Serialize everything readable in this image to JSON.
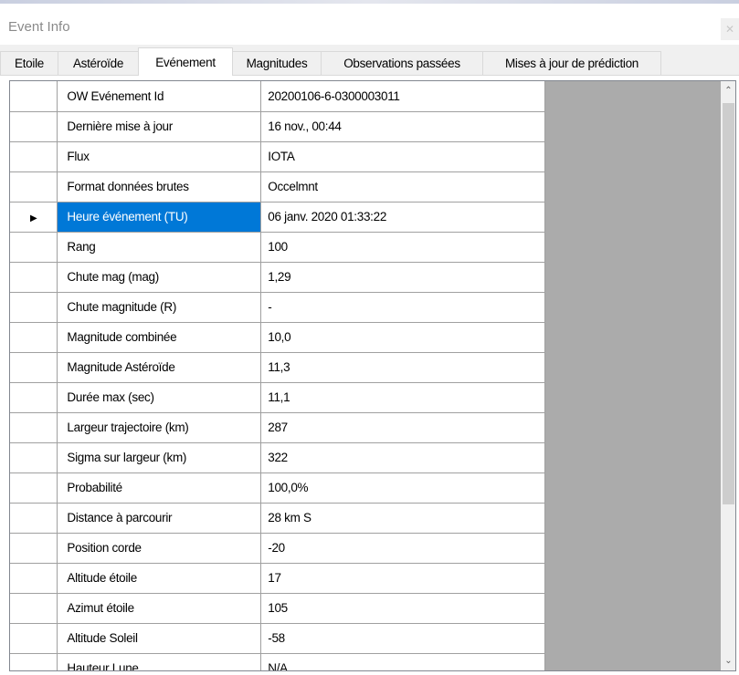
{
  "window": {
    "title": "Event Info",
    "close_glyph": "✕"
  },
  "tabs": [
    {
      "label": "Etoile",
      "active": false
    },
    {
      "label": "Astéroïde",
      "active": false
    },
    {
      "label": "Evénement",
      "active": true
    },
    {
      "label": "Magnitudes",
      "active": false
    },
    {
      "label": "Observations passées",
      "active": false
    },
    {
      "label": "Mises à jour de prédiction",
      "active": false
    }
  ],
  "grid": {
    "selected_row": 4,
    "row_indicator_icon": "right-triangle-icon",
    "row_indicator_glyph": "▶",
    "selection_color": "#0078d7",
    "rows": [
      {
        "name": "OW Evénement Id",
        "value": "20200106-6-0300003011"
      },
      {
        "name": "Dernière mise à jour",
        "value": "16 nov., 00:44"
      },
      {
        "name": "Flux",
        "value": "IOTA"
      },
      {
        "name": "Format données brutes",
        "value": "Occelmnt"
      },
      {
        "name": "Heure événement (TU)",
        "value": "06 janv. 2020 01:33:22"
      },
      {
        "name": "Rang",
        "value": "100"
      },
      {
        "name": "Chute mag (mag)",
        "value": "1,29"
      },
      {
        "name": "Chute magnitude (R)",
        "value": "-"
      },
      {
        "name": "Magnitude combinée",
        "value": "10,0"
      },
      {
        "name": "Magnitude Astéroïde",
        "value": "11,3"
      },
      {
        "name": "Durée max (sec)",
        "value": "11,1"
      },
      {
        "name": "Largeur trajectoire (km)",
        "value": "287"
      },
      {
        "name": "Sigma sur largeur (km)",
        "value": "322"
      },
      {
        "name": "Probabilité",
        "value": "100,0%"
      },
      {
        "name": "Distance à parcourir",
        "value": "28 km S"
      },
      {
        "name": "Position corde",
        "value": "-20"
      },
      {
        "name": "Altitude étoile",
        "value": "17"
      },
      {
        "name": "Azimut étoile",
        "value": "105"
      },
      {
        "name": "Altitude Soleil",
        "value": "-58"
      },
      {
        "name": "Hauteur Lune",
        "value": "N/A"
      }
    ]
  },
  "scrollbar": {
    "up_glyph": "⌃",
    "down_glyph": "⌄"
  }
}
